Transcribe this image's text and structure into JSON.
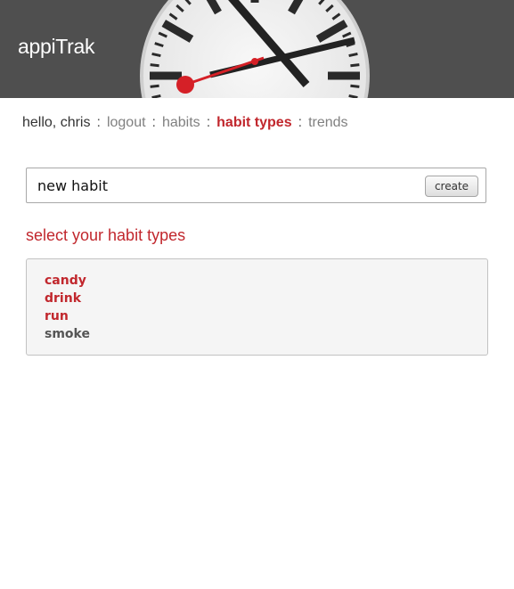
{
  "header": {
    "app_title": "appiTrak",
    "clock_image": "clock-icon"
  },
  "nav": {
    "greeting": "hello, chris",
    "separator": ":",
    "logout": "logout",
    "habits": "habits",
    "habit_types": "habit types",
    "trends": "trends",
    "active_item": "habit types"
  },
  "new_habit": {
    "input_value": "new habit",
    "create_label": "create"
  },
  "section": {
    "heading": "select your habit types"
  },
  "habit_types": [
    {
      "label": "candy",
      "selected": true
    },
    {
      "label": "drink",
      "selected": true
    },
    {
      "label": "run",
      "selected": true
    },
    {
      "label": "smoke",
      "selected": false
    }
  ],
  "colors": {
    "accent": "#c1272d",
    "header_bg": "#4f4f4f",
    "link": "#808080"
  }
}
